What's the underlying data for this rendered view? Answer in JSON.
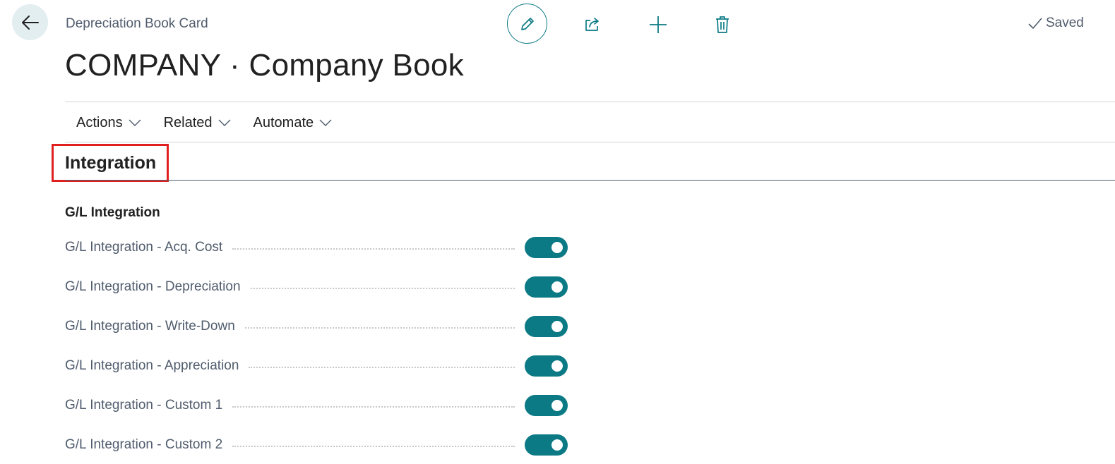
{
  "header": {
    "breadcrumb": "Depreciation Book Card",
    "title": "COMPANY · Company Book",
    "saved_label": "Saved"
  },
  "actionbar": {
    "items": [
      {
        "label": "Actions"
      },
      {
        "label": "Related"
      },
      {
        "label": "Automate"
      }
    ]
  },
  "section": {
    "title": "Integration",
    "group_title": "G/L Integration",
    "fields": [
      {
        "label": "G/L Integration - Acq. Cost",
        "value": true
      },
      {
        "label": "G/L Integration - Depreciation",
        "value": true
      },
      {
        "label": "G/L Integration - Write-Down",
        "value": true
      },
      {
        "label": "G/L Integration - Appreciation",
        "value": true
      },
      {
        "label": "G/L Integration - Custom 1",
        "value": true
      },
      {
        "label": "G/L Integration - Custom 2",
        "value": true
      }
    ]
  },
  "colors": {
    "accent": "#0b7a85",
    "highlight": "#e02020"
  },
  "icons": {
    "back": "arrow-left-icon",
    "edit": "pencil-icon",
    "share": "share-icon",
    "add": "plus-icon",
    "delete": "trash-icon",
    "saved": "check-icon",
    "dropdown": "chevron-down-icon"
  }
}
